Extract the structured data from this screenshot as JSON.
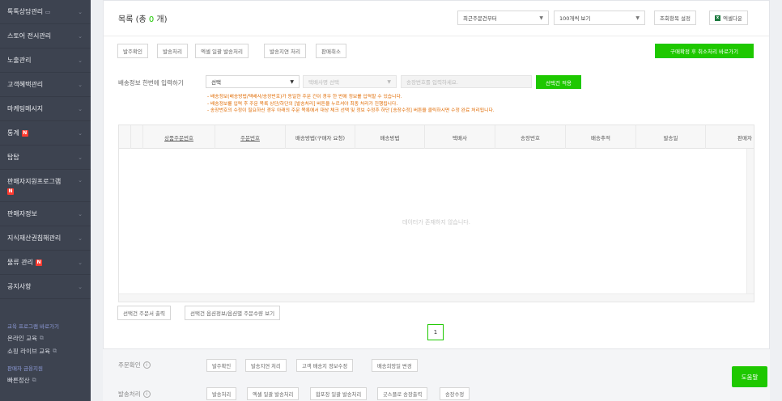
{
  "sidebar": {
    "items": [
      {
        "label": "톡톡상담관리",
        "icon": "chat-icon"
      },
      {
        "label": "스토어 전시관리"
      },
      {
        "label": "노출관리"
      },
      {
        "label": "고객혜택관리"
      },
      {
        "label": "마케팅메시지"
      },
      {
        "label": "통계",
        "badge": "N"
      },
      {
        "label": "탑탑"
      },
      {
        "label": "판매자지원프로그램",
        "badge": "N"
      },
      {
        "label": "판매자정보"
      },
      {
        "label": "지식재산권침해관리"
      },
      {
        "label": "물류 관리",
        "badge": "N"
      },
      {
        "label": "공지사항"
      }
    ],
    "edu_title": "교육 프로그램 바로가기",
    "edu_links": [
      "온라인 교육",
      "쇼핑 라이브 교육"
    ],
    "finance_title": "판매자 금융지원",
    "finance_link": "빠른정산"
  },
  "list": {
    "title_prefix": "목록 (총 ",
    "count": "0",
    "title_suffix": " 개)",
    "sort_select": "최근주문건부터",
    "page_size_select": "100개씩 보기",
    "column_settings_button": "조회항목 설정",
    "excel_button": "엑셀다운"
  },
  "actions": {
    "buttons": [
      "발주확인",
      "발송처리",
      "엑셀 일괄 발송처리",
      "발송지연 처리",
      "판매취소"
    ],
    "cancel_after_purchase_button": "구매확정 후 취소처리 바로가기"
  },
  "bulk": {
    "label": "배송정보 한번에 입력하기",
    "method_select": "선택",
    "courier_placeholder": "택배사명 선택",
    "tracking_placeholder": "송장번호를 입력하세요.",
    "apply_button": "선택건 적용",
    "notes": [
      "- 배송정보(배송방법/택배사/송장번호)가 동일한 주문 건이 경우 한 번에 정보를 입력할 수 있습니다.",
      "- 배송정보를 입력 후 주문 목록 상단/하단의 [발송처리] 버튼을 누르셔야 최종 처리가 진행됩니다.",
      "- 송장번호의 수정이 필요하신 경우 아래의 주문 목록에서 대상 체크 선택 및 정보 수정후 하단 [송장수정] 버튼을 클릭하시면 수정 완료 처리됩니다."
    ]
  },
  "table": {
    "columns": [
      "상품주문번호",
      "주문번호",
      "배송방법(구매자 요청)",
      "배송방법",
      "택배사",
      "송장번호",
      "배송추적",
      "발송일",
      "판매자"
    ],
    "empty_message": "데이터가 존재하지 않습니다."
  },
  "below_table_buttons": [
    "선택건 주문서 출력",
    "선택건 옵션정보/옵션별 주문수량 보기"
  ],
  "pagination": {
    "current": "1"
  },
  "bottom": {
    "order_confirm_label": "주문확인",
    "order_confirm_buttons": [
      "발주확인",
      "발송지연 처리",
      "고객 배송지 정보수정",
      "배송희망일 변경"
    ],
    "shipping_label": "발송처리",
    "shipping_buttons": [
      "발송처리",
      "엑셀 일괄 발송처리",
      "합포장 일괄 발송처리",
      "굿스플로 송장출력",
      "송장수정"
    ]
  },
  "help_button": "도움말",
  "colors": {
    "accent": "#1ec800",
    "sidebar_bg": "#3d4350",
    "badge": "#ff3b30",
    "notes": "#e06a00"
  }
}
